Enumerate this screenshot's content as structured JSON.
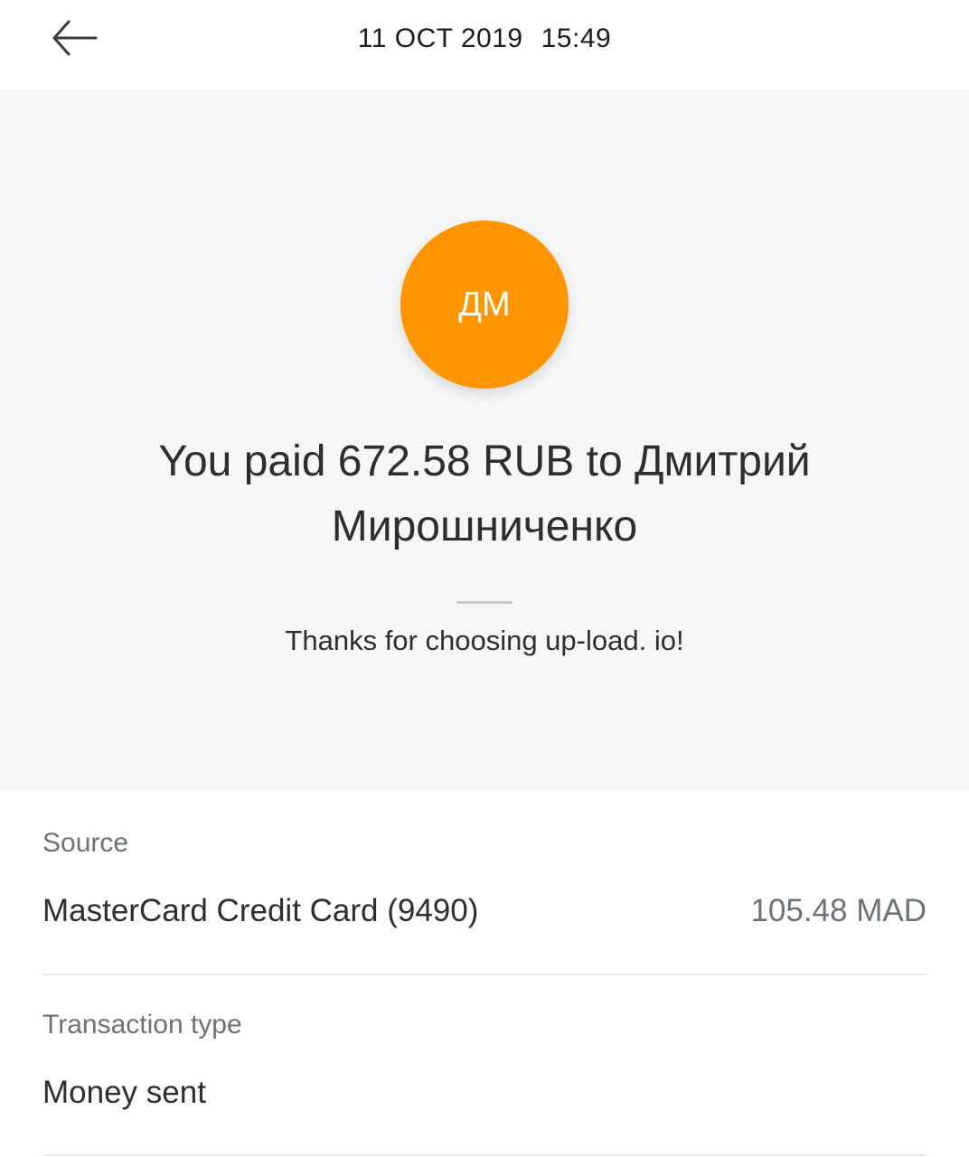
{
  "header": {
    "back_icon": "arrow-left-icon",
    "date": "11 OCT 2019",
    "time": "15:49"
  },
  "summary": {
    "avatar_initials": "ДМ",
    "avatar_color": "#ff9600",
    "headline": "You paid 672.58 RUB to Дмитрий Мирошниченко",
    "thanks_message": "Thanks for choosing up-load. io!"
  },
  "details": [
    {
      "label": "Source",
      "value": "MasterCard Credit Card (9490)",
      "amount": "105.48 MAD"
    },
    {
      "label": "Transaction type",
      "value": "Money sent"
    }
  ]
}
